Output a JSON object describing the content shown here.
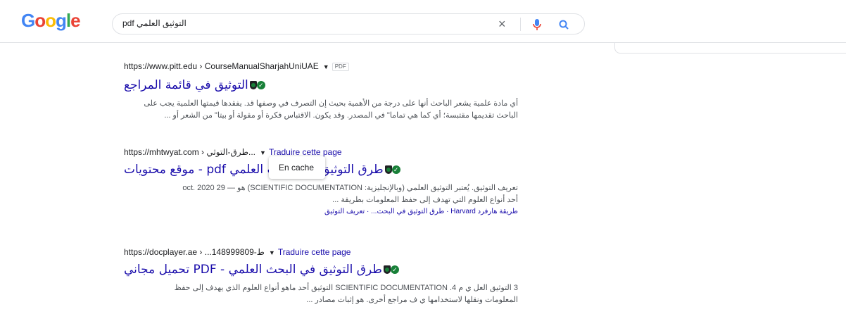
{
  "logo": {
    "letters": [
      "G",
      "o",
      "o",
      "g",
      "l",
      "e"
    ],
    "colors": [
      "#4285f4",
      "#ea4335",
      "#fbbc05",
      "#4285f4",
      "#34a853",
      "#ea4335"
    ]
  },
  "search": {
    "query": "pdf التوثيق العلمي",
    "clear_icon": "×"
  },
  "results": [
    {
      "url": "https://www.pitt.edu › CourseManualSharjahUniUAE",
      "tag": "PDF",
      "title": "التوثيق في قائمة المراجع",
      "snippet1": "أي مادة علمية يشعر الباحث أنها على درجة من الأهمية بحيث إن التصرف في وصفها قد. يفقدها قيمتها العلمية يجب على",
      "snippet2": "الباحث تقديمها مقتبسة؛ أي كما هي تماما\" في المصدر. وقد يكون. الاقتباس فكرة أو مقولة أو بيتا\" من الشعر أو ..."
    },
    {
      "url": "https://mhtwyat.com › طرق-التوثي...",
      "translate": "Traduire cette page",
      "title": "طرق التوثيق في البحث العلمي pdf - موقع محتويات",
      "snippet1": "تعريف التوثيق. يُعتبر التوثيق العلمي (وبالإنجليزية: SCIENTIFIC DOCUMENTATION) هو — 29 oct. 2020",
      "snippet2": "أحد أنواع العلوم التي تهدف إلى حفظ المعلومات بطريقة ...",
      "links": "طريقة هارفرد Harvard · طرق التوثيق في البحث... · تعريف التوثيق"
    },
    {
      "url": "https://docplayer.ae › ...148999809-ط",
      "translate": "Traduire cette page",
      "title": "طرق التوثيق في البحث العلمي - PDF تحميل مجاني",
      "snippet1": "3 التوثيق العل ي م 4. SCIENTIFIC DOCUMENTATION التوثيق أحد ماهو أنواع العلوم الذي يهدف إلى حفظ",
      "snippet2": "المعلومات ونقلها لاستخدامها ي ف مراجع أخرى. هو إثبات مصادر ..."
    }
  ],
  "popup": {
    "label": "En cache"
  }
}
